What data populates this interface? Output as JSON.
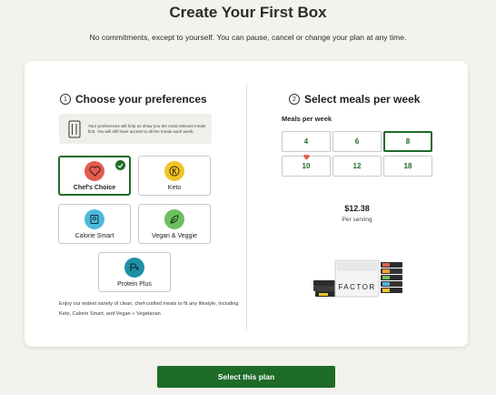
{
  "header": {
    "title": "Create Your First Box",
    "subtitle": "No commitments, except to yourself. You can pause, cancel or change your plan at any time."
  },
  "preferences": {
    "step_number": "1",
    "heading": "Choose your preferences",
    "info_text": "Your preferences will help us show you the most relevant meals first. You will still have access to all the meals each week.",
    "options": [
      {
        "label": "Chef's Choice",
        "icon": "heart-icon",
        "color": "#e35d4f",
        "selected": true
      },
      {
        "label": "Keto",
        "icon": "keto-k-icon",
        "color": "#f2c428",
        "selected": false
      },
      {
        "label": "Calorie Smart",
        "icon": "scale-icon",
        "color": "#4fb8dc",
        "selected": false
      },
      {
        "label": "Vegan & Veggie",
        "icon": "leaf-icon",
        "color": "#6cbf5f",
        "selected": false
      },
      {
        "label": "Protein Plus",
        "icon": "protein-icon",
        "color": "#1f8fa6",
        "selected": false
      }
    ],
    "description": "Enjoy our widest variety of clean, chef-crafted meals to fit any lifestyle, including Keto, Calorie Smart, and Vegan + Vegetarian"
  },
  "meals": {
    "step_number": "2",
    "heading": "Select meals per week",
    "label": "Meals per week",
    "options": [
      "4",
      "6",
      "8",
      "10",
      "12",
      "18"
    ],
    "selected": "8",
    "favorite": "10",
    "price": "$12.38",
    "price_unit": "Per serving",
    "brand_text": "FACTOR"
  },
  "cta": {
    "label": "Select this plan"
  },
  "colors": {
    "brand_green": "#1f6b28",
    "background": "#f3f2ed"
  }
}
